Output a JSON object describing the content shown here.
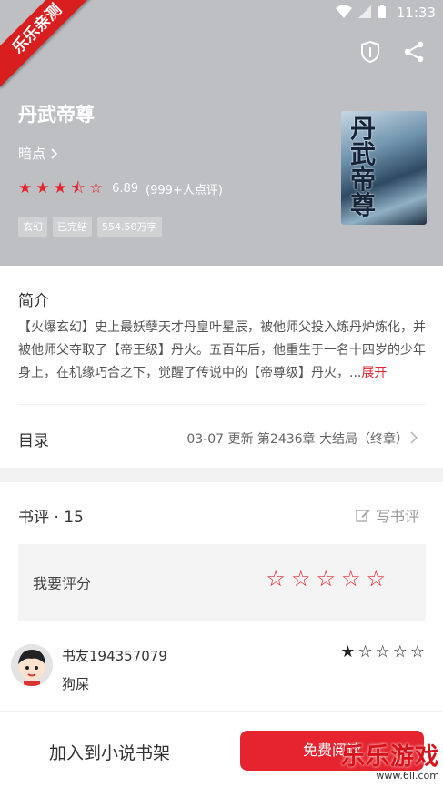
{
  "status": {
    "time": "11:33"
  },
  "ribbon": {
    "text": "乐乐亲测"
  },
  "book": {
    "title": "丹武帝尊",
    "author": "暗点",
    "score": "6.89",
    "rating_count": "(999+人点评)",
    "rating_stars": 3.5,
    "tags": [
      "玄幻",
      "已完结",
      "554.50万字"
    ],
    "cover_text": "丹武帝尊"
  },
  "intro": {
    "title": "简介",
    "text": "【火爆玄幻】史上最妖孽天才丹皇叶星辰，被他师父投入炼丹炉炼化，并被他师父夺取了【帝王级】丹火。五百年后，他重生于一名十四岁的少年身上，在机缘巧合之下，觉醒了传说中的【帝尊级】丹火，...",
    "expand": "展开"
  },
  "catalog": {
    "title": "目录",
    "latest": "03-07  更新  第2436章 大结局（终章）"
  },
  "reviews": {
    "title": "书评 · 15",
    "write_label": "写书评",
    "rate_label": "我要评分",
    "comment": {
      "user": "书友194357079",
      "content": "狗屎",
      "stars": 1
    }
  },
  "bottom": {
    "add_shelf": "加入到小说书架",
    "read_free": "免费阅读"
  },
  "watermark": {
    "line1": "乐乐游戏",
    "line2": "www.6ll.com"
  },
  "colors": {
    "accent": "#e5242f",
    "header_bg": "#bdbfc2"
  }
}
